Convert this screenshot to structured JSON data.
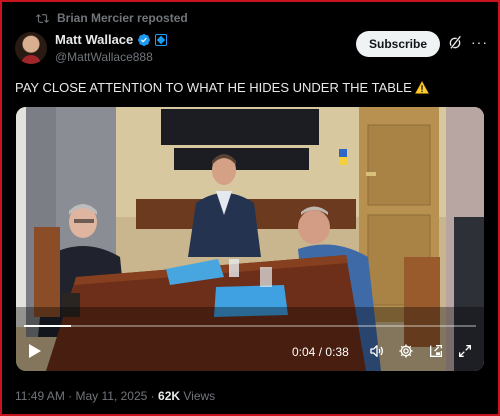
{
  "repost": {
    "label": "Brian Mercier reposted",
    "icon": "repost-icon"
  },
  "author": {
    "display_name": "Matt Wallace",
    "handle": "@MattWallace888",
    "verified_icon": "verified-badge-icon",
    "affiliate_icon": "affiliate-badge-icon"
  },
  "actions": {
    "subscribe_label": "Subscribe",
    "grok_icon": "grok-icon",
    "more_icon": "more-options-icon"
  },
  "tweet": {
    "text": "PAY CLOSE ATTENTION TO WHAT HE HIDES UNDER THE TABLE",
    "emoji": "warning-icon"
  },
  "video": {
    "current_time": "0:04",
    "separator": "/",
    "duration": "0:38",
    "progress": 0.105
  },
  "meta": {
    "time": "11:49 AM",
    "dot1": "·",
    "date": "May 11, 2025",
    "dot2": "·",
    "views_count": "62K",
    "views_label": "Views"
  },
  "colors": {
    "accent": "#1d9bf0",
    "border": "#c8141e",
    "muted": "#71767b"
  }
}
